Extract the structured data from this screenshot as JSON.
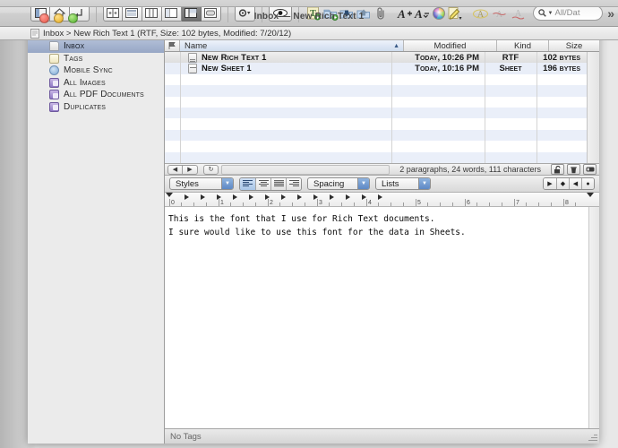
{
  "window": {
    "title": "Inbox — New Rich Text 1",
    "traffic_lights": [
      "close-button",
      "minimize-button",
      "zoom-button"
    ]
  },
  "toolbar": {
    "view_group": [
      {
        "name": "sidebar-toggle-button",
        "icon": "sidebar-icon"
      },
      {
        "name": "home-button",
        "icon": "home-icon"
      },
      {
        "name": "go-back-parent-button",
        "icon": "arrow-up-left-icon"
      }
    ],
    "layout_group": [
      {
        "name": "layout-columns-button",
        "icon": "layout-split-icon",
        "active": false
      },
      {
        "name": "layout-list-button",
        "icon": "layout-list-icon",
        "active": false
      },
      {
        "name": "layout-three-pane-button",
        "icon": "layout-three-pane-icon",
        "active": false
      },
      {
        "name": "layout-two-pane-button",
        "icon": "layout-two-pane-icon",
        "active": false
      },
      {
        "name": "layout-widescreen-button",
        "icon": "layout-widescreen-icon",
        "active": true
      },
      {
        "name": "layout-single-button",
        "icon": "layout-single-icon",
        "active": false
      }
    ],
    "action_button": {
      "name": "action-gear-button",
      "icon": "gear-icon",
      "label": "⚙"
    },
    "preview_button": {
      "name": "preview-eye-button",
      "icon": "eye-icon"
    },
    "item_group": [
      {
        "name": "new-text-button",
        "icon": "new-text-icon",
        "label": "T"
      },
      {
        "name": "new-group-button",
        "icon": "new-group-folder-icon"
      },
      {
        "name": "move-to-group-button",
        "icon": "move-to-group-icon"
      },
      {
        "name": "replicate-button",
        "icon": "replicate-folder-icon"
      },
      {
        "name": "attach-link-button",
        "icon": "paperclip-icon"
      }
    ],
    "font_group": [
      {
        "name": "increase-font-size-button",
        "icon": "font-bigger-icon",
        "label": "A"
      },
      {
        "name": "decrease-font-size-button",
        "icon": "font-smaller-icon",
        "label": "A"
      },
      {
        "name": "colors-button",
        "icon": "color-wheel-icon"
      },
      {
        "name": "highlight-button",
        "icon": "highlighter-pen-icon"
      }
    ],
    "markup_group": [
      {
        "name": "annotate-button",
        "icon": "annotate-circle-icon",
        "label": "A"
      },
      {
        "name": "strikethrough-button",
        "icon": "strikethrough-icon",
        "label": "A"
      },
      {
        "name": "underline-button",
        "icon": "underline-icon",
        "label": "A"
      }
    ],
    "search": {
      "name": "search-field",
      "icon": "search-icon",
      "value": "",
      "placeholder": "All/Dat"
    },
    "overflow_button": {
      "name": "toolbar-overflow-button",
      "label": "»"
    }
  },
  "pathbar": {
    "icon": "document-icon",
    "text": "Inbox > New Rich Text 1 (RTF, Size: 102 bytes, Modified: 7/20/12)"
  },
  "sidebar": {
    "items": [
      {
        "label": "Inbox",
        "icon": "inbox-document-icon",
        "selected": true
      },
      {
        "label": "Tags",
        "icon": "tag-icon",
        "selected": false
      },
      {
        "label": "Mobile Sync",
        "icon": "sync-icon",
        "selected": false
      },
      {
        "label": "All Images",
        "icon": "smart-group-icon",
        "selected": false
      },
      {
        "label": "All PDF Documents",
        "icon": "smart-group-icon",
        "selected": false
      },
      {
        "label": "Duplicates",
        "icon": "smart-group-icon",
        "selected": false
      }
    ]
  },
  "filelist": {
    "columns": [
      {
        "key": "flag",
        "label": "",
        "icon": "flag-icon"
      },
      {
        "key": "name",
        "label": "Name",
        "sorted": true,
        "sort_direction": "ascending"
      },
      {
        "key": "modified",
        "label": "Modified"
      },
      {
        "key": "kind",
        "label": "Kind"
      },
      {
        "key": "size",
        "label": "Size"
      }
    ],
    "rows": [
      {
        "name": "New Rich Text 1",
        "modified": "Today, 10:26 PM",
        "kind": "RTF",
        "size": "102 bytes",
        "icon": "rtf-document-icon",
        "selected": true
      },
      {
        "name": "New Sheet 1",
        "modified": "Today, 10:16 PM",
        "kind": "Sheet",
        "size": "196 bytes",
        "icon": "sheet-document-icon",
        "selected": false
      }
    ]
  },
  "liststatus": {
    "back_button": {
      "name": "back-button",
      "label": "◀"
    },
    "forward_button": {
      "name": "forward-button",
      "label": "▶"
    },
    "reload_button": {
      "name": "reload-button",
      "label": "↻"
    },
    "counts": "2 paragraphs, 24 words, 111 characters",
    "lock_button": {
      "name": "lock-button",
      "icon": "unlocked-padlock-icon"
    },
    "trash_button": {
      "name": "trash-button",
      "icon": "trash-icon"
    },
    "inspector_button": {
      "name": "inspector-button",
      "icon": "inspector-bar-icon"
    }
  },
  "formatbar": {
    "styles": {
      "label": "Styles",
      "name": "styles-popup"
    },
    "alignment": [
      {
        "name": "align-left-button",
        "active": true
      },
      {
        "name": "align-center-button",
        "active": false
      },
      {
        "name": "align-right-button",
        "active": false
      },
      {
        "name": "align-justify-button",
        "active": false
      }
    ],
    "spacing": {
      "label": "Spacing",
      "name": "spacing-popup"
    },
    "lists": {
      "label": "Lists",
      "name": "lists-popup"
    },
    "nubs": [
      {
        "name": "play-nub-button",
        "label": "▶"
      },
      {
        "name": "diamond-nub-button",
        "label": "◆"
      },
      {
        "name": "back-nub-button",
        "label": "◀"
      },
      {
        "name": "circle-nub-button",
        "label": "●"
      }
    ]
  },
  "ruler": {
    "numbers": [
      "0",
      "1",
      "2",
      "3",
      "4",
      "5",
      "6",
      "7",
      "8"
    ],
    "unit": "inches"
  },
  "document": {
    "lines": [
      "This is the font that I use for Rich Text documents.",
      "I sure would like to use this font for the data in Sheets."
    ]
  },
  "tagbar": {
    "placeholder": "No Tags",
    "value": ""
  },
  "colors": {
    "selection_blue": "#97a7c5",
    "row_stripe": "#eaeff9",
    "toolbar_gray": "#d6d6d6",
    "popup_arrow_blue": "#5d88c4"
  }
}
